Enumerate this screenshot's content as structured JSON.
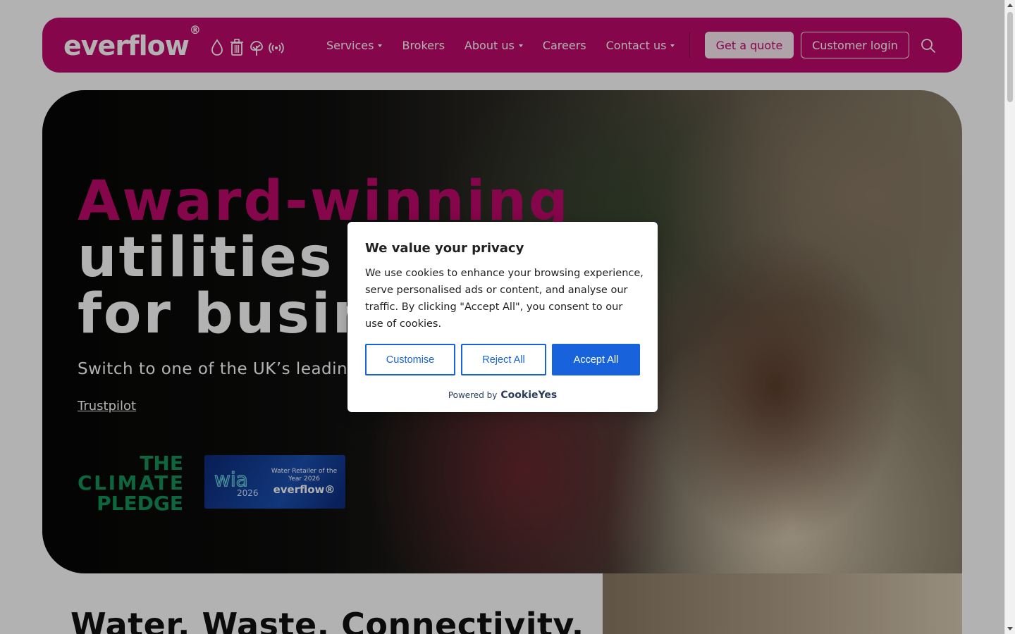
{
  "brand": {
    "logo_text": "everflow",
    "logo_reg": "®",
    "icons": [
      "water-drop-icon",
      "bin-icon",
      "energy-tree-icon",
      "signal-icon"
    ],
    "accent_color": "#c10a6c"
  },
  "nav": {
    "items": [
      {
        "label": "Services",
        "dropdown": true
      },
      {
        "label": "Brokers",
        "dropdown": false
      },
      {
        "label": "About us",
        "dropdown": true
      },
      {
        "label": "Careers",
        "dropdown": false
      },
      {
        "label": "Contact us",
        "dropdown": true
      }
    ],
    "quote_button": "Get a quote",
    "login_button": "Customer login",
    "search_icon": "search-icon"
  },
  "hero": {
    "heading_accent": "Award-winning",
    "heading_line2": "utilities s",
    "heading_line3": "for busin",
    "subheading": "Switch to one of the UK’s leading",
    "trustpilot_link": "Trustpilot",
    "climate_pledge": [
      "THE",
      "CLIMATE",
      "PLEDGE"
    ],
    "award": {
      "logo_text": "wia",
      "logo_year": "2026",
      "title": "Water Retailer of the Year 2026",
      "brand": "everflow®"
    }
  },
  "lower_section": {
    "heading": "Water. Waste. Connectivity."
  },
  "cookie_modal": {
    "title": "We value your privacy",
    "body": "We use cookies to enhance your browsing experience, serve personalised ads or content, and analyse our traffic. By clicking \"Accept All\", you consent to our use of cookies.",
    "customise_button": "Customise",
    "reject_button": "Reject All",
    "accept_button": "Accept All",
    "powered_by": "Powered by",
    "powered_brand": "CookieYes",
    "button_color": "#1863dc"
  }
}
